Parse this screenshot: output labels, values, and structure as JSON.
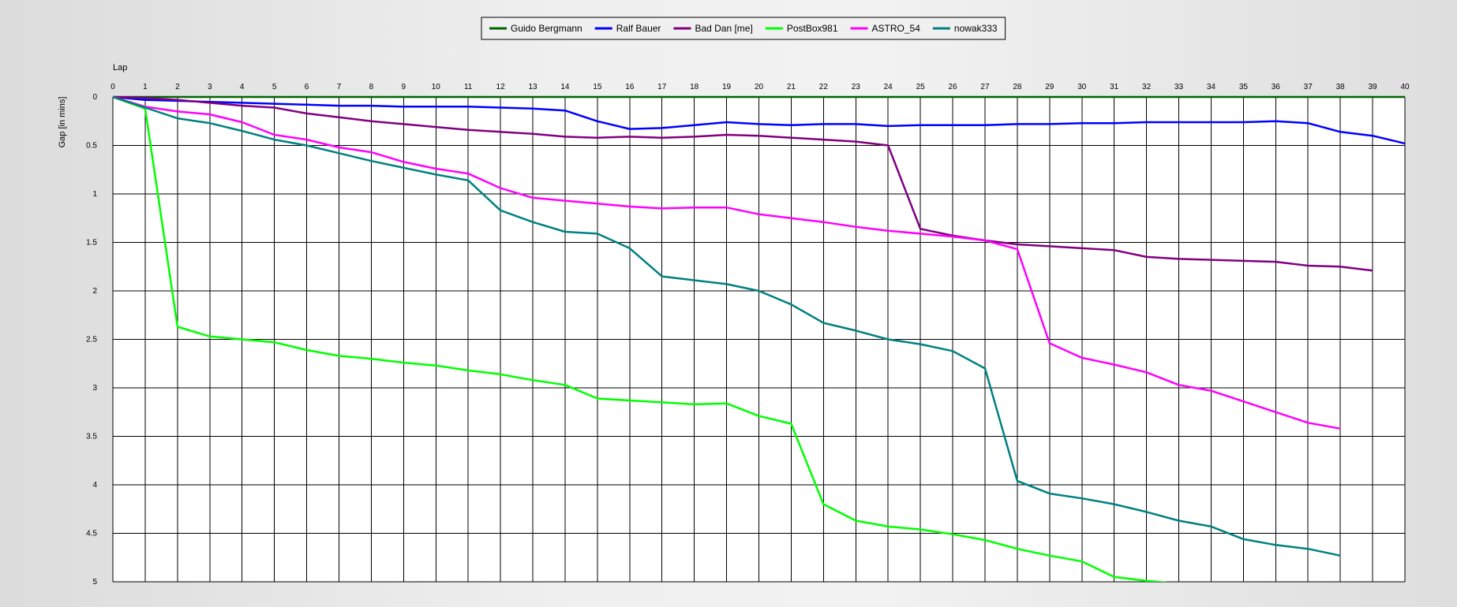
{
  "chart_data": {
    "type": "line",
    "xlabel": "Lap",
    "ylabel": "Gap [in mins]",
    "xlim": [
      0,
      40
    ],
    "ylim": [
      0,
      5
    ],
    "y_axis_inverted": true,
    "grid": true,
    "legend_position": "top-center",
    "x_ticks": [
      0,
      1,
      2,
      3,
      4,
      5,
      6,
      7,
      8,
      9,
      10,
      11,
      12,
      13,
      14,
      15,
      16,
      17,
      18,
      19,
      20,
      21,
      22,
      23,
      24,
      25,
      26,
      27,
      28,
      29,
      30,
      31,
      32,
      33,
      34,
      35,
      36,
      37,
      38,
      39,
      40
    ],
    "y_ticks": [
      "0",
      "0.5",
      "1",
      "1.5",
      "2",
      "2.5",
      "3",
      "3.5",
      "4",
      "4.5",
      "5"
    ],
    "series": [
      {
        "name": "Guido Bergmann",
        "color": "#006400",
        "x": [
          0,
          40
        ],
        "values": [
          0,
          0
        ]
      },
      {
        "name": "Ralf Bauer",
        "color": "#0000ff",
        "x": [
          0,
          1,
          2,
          3,
          4,
          5,
          6,
          7,
          8,
          9,
          10,
          11,
          12,
          13,
          14,
          15,
          16,
          17,
          18,
          19,
          20,
          21,
          22,
          23,
          24,
          25,
          26,
          27,
          28,
          29,
          30,
          31,
          32,
          33,
          34,
          35,
          36,
          37,
          38,
          39,
          40
        ],
        "values": [
          0,
          0.03,
          0.04,
          0.05,
          0.06,
          0.07,
          0.08,
          0.09,
          0.09,
          0.1,
          0.1,
          0.1,
          0.11,
          0.12,
          0.14,
          0.25,
          0.33,
          0.32,
          0.29,
          0.26,
          0.28,
          0.29,
          0.28,
          0.28,
          0.3,
          0.29,
          0.29,
          0.29,
          0.28,
          0.28,
          0.27,
          0.27,
          0.26,
          0.26,
          0.26,
          0.26,
          0.25,
          0.27,
          0.36,
          0.4,
          0.48
        ]
      },
      {
        "name": "Bad Dan [me]",
        "color": "#800080",
        "x": [
          0,
          1,
          2,
          3,
          4,
          5,
          6,
          7,
          8,
          9,
          10,
          11,
          12,
          13,
          14,
          15,
          16,
          17,
          18,
          19,
          20,
          21,
          22,
          23,
          24,
          25,
          26,
          27,
          28,
          29,
          30,
          31,
          32,
          33,
          34,
          35,
          36,
          37,
          38,
          39
        ],
        "values": [
          0,
          0.01,
          0.03,
          0.06,
          0.09,
          0.11,
          0.17,
          0.21,
          0.25,
          0.28,
          0.31,
          0.34,
          0.36,
          0.38,
          0.41,
          0.42,
          0.41,
          0.42,
          0.41,
          0.39,
          0.4,
          0.42,
          0.44,
          0.46,
          0.5,
          1.36,
          1.43,
          1.48,
          1.52,
          1.54,
          1.56,
          1.58,
          1.65,
          1.67,
          1.68,
          1.69,
          1.7,
          1.74,
          1.75,
          1.79
        ]
      },
      {
        "name": "PostBox981",
        "color": "#00ff00",
        "x": [
          0,
          1,
          2,
          3,
          4,
          5,
          6,
          7,
          8,
          9,
          10,
          11,
          12,
          13,
          14,
          15,
          16,
          17,
          18,
          19,
          20,
          21,
          22,
          23,
          24,
          25,
          26,
          27,
          28,
          29,
          30,
          31,
          32,
          33
        ],
        "values": [
          0,
          0.12,
          2.37,
          2.47,
          2.5,
          2.53,
          2.61,
          2.67,
          2.7,
          2.74,
          2.77,
          2.82,
          2.86,
          2.92,
          2.97,
          3.11,
          3.13,
          3.15,
          3.17,
          3.16,
          3.29,
          3.37,
          4.2,
          4.37,
          4.43,
          4.46,
          4.51,
          4.57,
          4.66,
          4.73,
          4.79,
          4.95,
          4.99,
          5.02
        ]
      },
      {
        "name": "ASTRO_54",
        "color": "#ff00ff",
        "x": [
          0,
          1,
          2,
          3,
          4,
          5,
          6,
          7,
          8,
          9,
          10,
          11,
          12,
          13,
          14,
          15,
          16,
          17,
          18,
          19,
          20,
          21,
          22,
          23,
          24,
          25,
          26,
          27,
          28,
          29,
          30,
          31,
          32,
          33,
          34,
          35,
          36,
          37,
          38
        ],
        "values": [
          0,
          0.1,
          0.15,
          0.18,
          0.26,
          0.39,
          0.44,
          0.52,
          0.57,
          0.67,
          0.74,
          0.79,
          0.94,
          1.04,
          1.07,
          1.1,
          1.13,
          1.15,
          1.14,
          1.14,
          1.21,
          1.25,
          1.29,
          1.34,
          1.38,
          1.41,
          1.44,
          1.48,
          1.57,
          2.54,
          2.69,
          2.76,
          2.84,
          2.97,
          3.03,
          3.14,
          3.25,
          3.36,
          3.42
        ]
      },
      {
        "name": "nowak333",
        "color": "#008080",
        "x": [
          0,
          1,
          2,
          3,
          4,
          5,
          6,
          7,
          8,
          9,
          10,
          11,
          12,
          13,
          14,
          15,
          16,
          17,
          18,
          19,
          20,
          21,
          22,
          23,
          24,
          25,
          26,
          27,
          28,
          29,
          30,
          31,
          32,
          33,
          34,
          35,
          36,
          37,
          38
        ],
        "values": [
          0,
          0.11,
          0.22,
          0.27,
          0.35,
          0.44,
          0.5,
          0.58,
          0.66,
          0.73,
          0.8,
          0.86,
          1.17,
          1.29,
          1.39,
          1.41,
          1.56,
          1.85,
          1.89,
          1.93,
          2.0,
          2.14,
          2.33,
          2.41,
          2.5,
          2.55,
          2.62,
          2.8,
          3.96,
          4.09,
          4.14,
          4.2,
          4.28,
          4.37,
          4.43,
          4.56,
          4.62,
          4.66,
          4.73
        ]
      }
    ]
  }
}
